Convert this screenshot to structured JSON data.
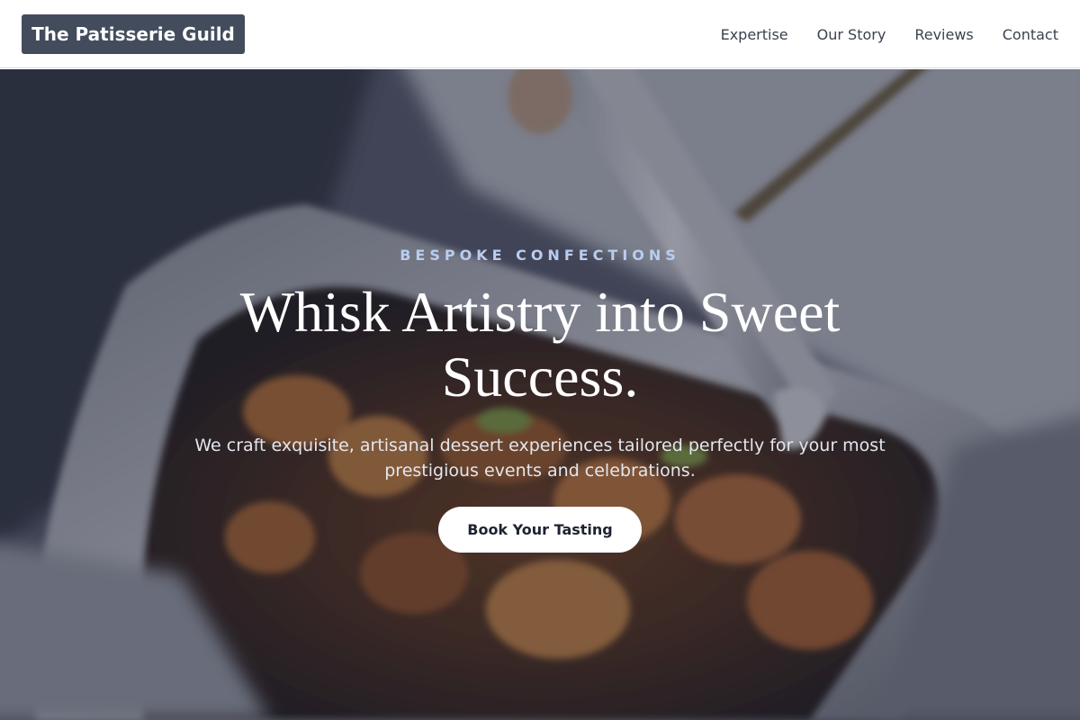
{
  "header": {
    "logo_text": "The Patisserie Guild",
    "nav": [
      {
        "label": "Expertise"
      },
      {
        "label": "Our Story"
      },
      {
        "label": "Reviews"
      },
      {
        "label": "Contact"
      }
    ]
  },
  "hero": {
    "eyebrow": "BESPOKE CONFECTIONS",
    "headline": "Whisk Artistry into Sweet Success.",
    "subtext": "We craft exquisite, artisanal dessert experiences tailored perfectly for your most prestigious events and celebrations.",
    "cta_label": "Book Your Tasting",
    "background_image": "food-tray-with-tongs-photo"
  },
  "colors": {
    "logo_bg": "#434c5c",
    "eyebrow": "#b9cdf0",
    "cta_bg": "#ffffff",
    "cta_text": "#1f2330"
  }
}
